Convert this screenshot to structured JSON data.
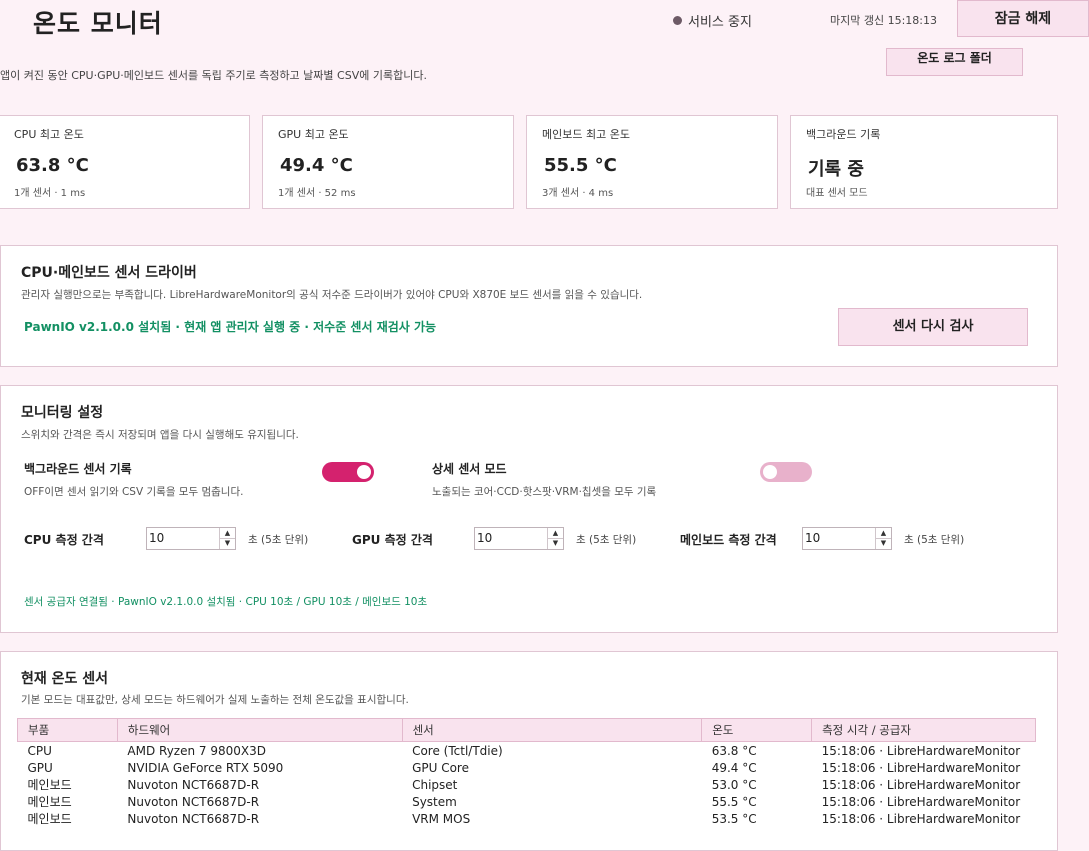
{
  "header": {
    "title": "온도 모니터",
    "status": "서비스 중지",
    "last_update": "마지막 갱신 15:18:13",
    "unlock_label": "잠금 해제",
    "folder_button_label": "온도 로그 폴더",
    "description": "앱이 켜진 동안 CPU·GPU·메인보드 센서를 독립 주기로 측정하고 날짜별 CSV에 기록합니다."
  },
  "stats": [
    {
      "label": "CPU 최고 온도",
      "value": "63.8 °C",
      "sub": "1개 센서 · 1 ms"
    },
    {
      "label": "GPU 최고 온도",
      "value": "49.4 °C",
      "sub": "1개 센서 · 52 ms"
    },
    {
      "label": "메인보드 최고 온도",
      "value": "55.5 °C",
      "sub": "3개 센서 · 4 ms"
    },
    {
      "label": "백그라운드 기록",
      "value": "기록 중",
      "sub": "대표 센서 모드"
    }
  ],
  "driver": {
    "title": "CPU·메인보드 센서 드라이버",
    "description": "관리자 실행만으로는 부족합니다. LibreHardwareMonitor의 공식 저수준 드라이버가 있어야 CPU와 X870E 보드 센서를 읽을 수 있습니다.",
    "status": "PawnIO v2.1.0.0 설치됨 · 현재 앱 관리자 실행 중 · 저수준 센서 재검사 가능",
    "rescan_label": "센서 다시 검사"
  },
  "settings": {
    "title": "모니터링 설정",
    "description": "스위치와 간격은 즉시 저장되며 앱을 다시 실행해도 유지됩니다.",
    "background": {
      "label": "백그라운드 센서 기록",
      "desc": "OFF이면 센서 읽기와 CSV 기록을 모두 멈춥니다.",
      "on": true
    },
    "detail": {
      "label": "상세 센서 모드",
      "desc": "노출되는 코어·CCD·핫스팟·VRM·칩셋을 모두 기록",
      "on": false
    },
    "intervals": [
      {
        "label": "CPU 측정 간격",
        "value": "10",
        "unit": "초 (5초 단위)"
      },
      {
        "label": "GPU 측정 간격",
        "value": "10",
        "unit": "초 (5초 단위)"
      },
      {
        "label": "메인보드 측정 간격",
        "value": "10",
        "unit": "초 (5초 단위)"
      }
    ],
    "footer_status": "센서 공급자 연결됨 · PawnIO v2.1.0.0 설치됨 · CPU 10초 / GPU 10초 / 메인보드 10초"
  },
  "sensors": {
    "title": "현재 온도 센서",
    "description": "기본 모드는 대표값만, 상세 모드는 하드웨어가 실제 노출하는 전체 온도값을 표시합니다.",
    "columns": [
      "부품",
      "하드웨어",
      "센서",
      "온도",
      "측정 시각 / 공급자"
    ],
    "rows": [
      [
        "CPU",
        "AMD Ryzen 7 9800X3D",
        "Core (Tctl/Tdie)",
        "63.8 °C",
        "15:18:06 · LibreHardwareMonitor"
      ],
      [
        "GPU",
        "NVIDIA GeForce RTX 5090",
        "GPU Core",
        "49.4 °C",
        "15:18:06 · LibreHardwareMonitor"
      ],
      [
        "메인보드",
        "Nuvoton NCT6687D-R",
        "Chipset",
        "53.0 °C",
        "15:18:06 · LibreHardwareMonitor"
      ],
      [
        "메인보드",
        "Nuvoton NCT6687D-R",
        "System",
        "55.5 °C",
        "15:18:06 · LibreHardwareMonitor"
      ],
      [
        "메인보드",
        "Nuvoton NCT6687D-R",
        "VRM MOS",
        "53.5 °C",
        "15:18:06 · LibreHardwareMonitor"
      ]
    ]
  }
}
